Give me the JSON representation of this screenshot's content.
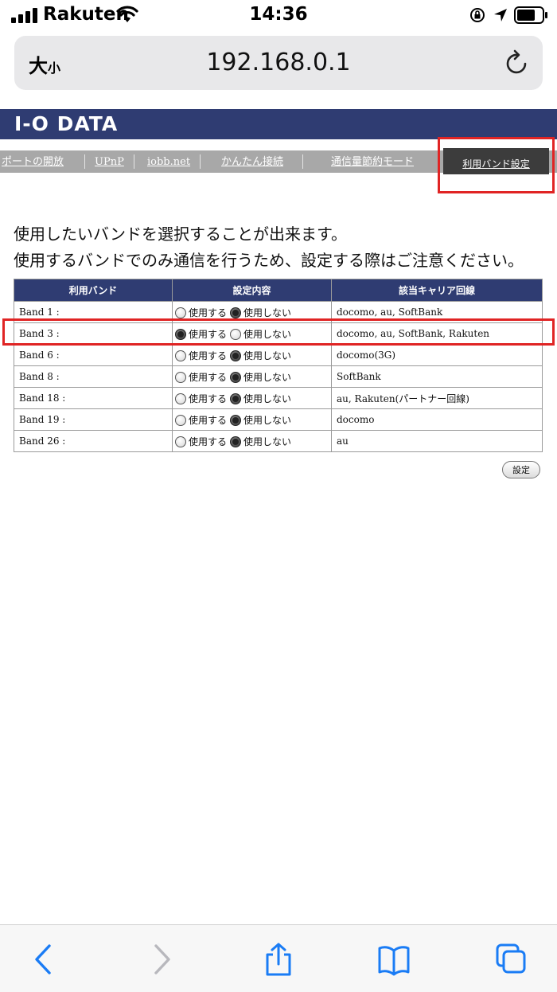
{
  "status_bar": {
    "carrier": "Rakuten",
    "time": "14:36"
  },
  "address_bar": {
    "text_size_large": "大",
    "text_size_small": "小",
    "url": "192.168.0.1"
  },
  "brand": {
    "logo_text": "I-O DATA",
    "color": "#2f3c72"
  },
  "nav": {
    "items": [
      "ポートの開放",
      "UPnP",
      "iobb.net",
      "かんたん接続",
      "通信量節約モード"
    ],
    "active": "利用バンド設定"
  },
  "description": {
    "line1": "使用したいバンドを選択することが出来ます。",
    "line2": "使用するバンドでのみ通信を行うため、設定する際はご注意ください。"
  },
  "table": {
    "headers": [
      "利用バンド",
      "設定内容",
      "該当キャリア回線"
    ],
    "option_use": "使用する",
    "option_no_use": "使用しない",
    "rows": [
      {
        "band": "Band 1 :",
        "use": false,
        "carriers": "docomo, au, SoftBank"
      },
      {
        "band": "Band 3 :",
        "use": true,
        "carriers": "docomo, au, SoftBank, Rakuten"
      },
      {
        "band": "Band 6 :",
        "use": false,
        "carriers": "docomo(3G)"
      },
      {
        "band": "Band 8 :",
        "use": false,
        "carriers": "SoftBank"
      },
      {
        "band": "Band 18 :",
        "use": false,
        "carriers": "au, Rakuten(パートナー回線)"
      },
      {
        "band": "Band 19 :",
        "use": false,
        "carriers": "docomo"
      },
      {
        "band": "Band 26 :",
        "use": false,
        "carriers": "au"
      }
    ]
  },
  "set_button": "設定",
  "colors": {
    "highlight": "#e02424",
    "ios_blue": "#1a7cf5"
  }
}
